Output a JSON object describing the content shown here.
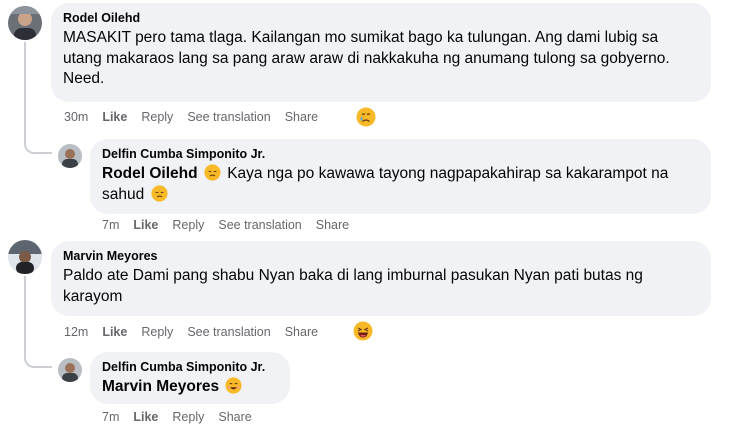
{
  "comments": [
    {
      "author": "Rodel Oilehd",
      "text": "MASAKIT pero tama tlaga. Kailangan mo sumikat bago ka tulungan. Ang dami lubig sa utang makaraos lang sa pang araw araw di nakkakuha ng anumang tulong sa gobyerno. Need.",
      "time": "30m",
      "like": "Like",
      "reply": "Reply",
      "translate": "See translation",
      "share": "Share",
      "reaction_icon": "crying-face-icon"
    },
    {
      "author": "Delfin Cumba Simponito Jr.",
      "mention": "Rodel Oilehd",
      "text_before_emoji": "Kaya nga po kawawa tayong nagpapakahirap sa kakarampot na sahud",
      "emoji_after_mention": "pensive-face-icon",
      "emoji_end": "pensive-face-icon",
      "time": "7m",
      "like": "Like",
      "reply": "Reply",
      "translate": "See translation",
      "share": "Share"
    },
    {
      "author": "Marvin Meyores",
      "text": "Paldo ate Dami pang shabu Nyan baka di lang imburnal pasukan Nyan pati butas ng karayom",
      "time": "12m",
      "like": "Like",
      "reply": "Reply",
      "translate": "See translation",
      "share": "Share",
      "reaction_icon": "laughing-face-icon"
    },
    {
      "author": "Delfin Cumba Simponito Jr.",
      "mention": "Marvin Meyores",
      "emoji_after_mention": "smiling-face-icon",
      "time": "7m",
      "like": "Like",
      "reply": "Reply",
      "share": "Share"
    }
  ],
  "colors": {
    "bubble": "#f0f2f5",
    "meta": "#65676b",
    "text": "#050505",
    "thread": "#ccd0d5"
  }
}
